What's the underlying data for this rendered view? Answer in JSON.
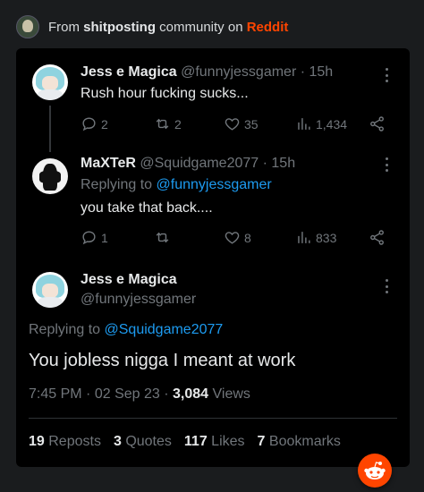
{
  "header": {
    "prefix": "From ",
    "community": "shitposting",
    "middle": " community on ",
    "platform": "Reddit"
  },
  "tweets": [
    {
      "name": "Jess e Magica",
      "handle": "@funnyjessgamer",
      "time": "15h",
      "text": "Rush hour fucking sucks...",
      "replies": "2",
      "reposts": "2",
      "likes": "35",
      "views": "1,434"
    },
    {
      "name": "MaXTeR",
      "handle": "@Squidgame2077",
      "time": "15h",
      "replying_prefix": "Replying to ",
      "replying_to": "@funnyjessgamer",
      "text": "you take that back....",
      "replies": "1",
      "reposts": "",
      "likes": "8",
      "views": "833"
    }
  ],
  "main": {
    "name": "Jess e Magica",
    "handle": "@funnyjessgamer",
    "replying_prefix": "Replying to ",
    "replying_to": "@Squidgame2077",
    "text": "You jobless nigga I meant at work",
    "time": "7:45 PM",
    "date": "02 Sep 23",
    "views_count": "3,084",
    "views_label": "Views",
    "stats": [
      {
        "num": "19",
        "label": "Reposts"
      },
      {
        "num": "3",
        "label": "Quotes"
      },
      {
        "num": "117",
        "label": "Likes"
      },
      {
        "num": "7",
        "label": "Bookmarks"
      }
    ]
  },
  "icons": [
    "reply-icon",
    "repost-icon",
    "like-icon",
    "views-icon",
    "share-icon",
    "more-icon",
    "reddit-icon"
  ],
  "colors": {
    "reddit": "#ff4500",
    "mention": "#1d9bf0",
    "muted": "#71767b"
  }
}
